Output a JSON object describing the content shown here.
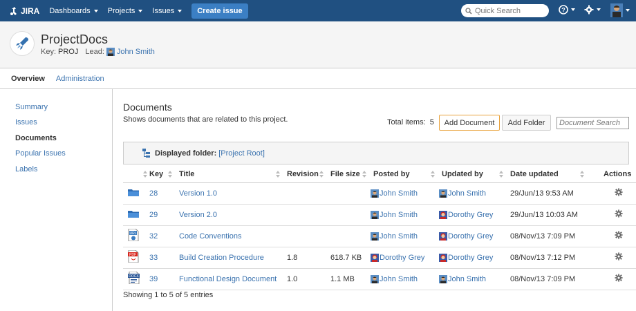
{
  "topnav": {
    "logo_text": "JIRA",
    "menu": [
      {
        "label": "Dashboards"
      },
      {
        "label": "Projects"
      },
      {
        "label": "Issues"
      }
    ],
    "create_label": "Create issue",
    "search_placeholder": "Quick Search",
    "brand_color": "#205081"
  },
  "project": {
    "name": "ProjectDocs",
    "key_label": "Key:",
    "key": "PROJ",
    "lead_label": "Lead:",
    "lead": "John Smith"
  },
  "tabs": [
    {
      "label": "Overview",
      "active": true
    },
    {
      "label": "Administration",
      "active": false
    }
  ],
  "sidebar": {
    "items": [
      {
        "label": "Summary"
      },
      {
        "label": "Issues"
      },
      {
        "label": "Documents"
      },
      {
        "label": "Popular Issues"
      },
      {
        "label": "Labels"
      }
    ]
  },
  "documents": {
    "title": "Documents",
    "subtitle": "Shows documents that are related to this project.",
    "total_label": "Total items:",
    "total": "5",
    "add_document": "Add Document",
    "add_folder": "Add Folder",
    "search_placeholder": "Document Search",
    "folder_label": "Displayed folder:",
    "folder_value": "[Project Root]",
    "columns": [
      "Key",
      "Title",
      "Revision",
      "File size",
      "Posted by",
      "Updated by",
      "Date updated",
      "Actions"
    ],
    "rows": [
      {
        "icon": "folder-icon",
        "key": "28",
        "title": "Version 1.0",
        "revision": "",
        "size": "",
        "posted_by": "John Smith",
        "posted_av": "john",
        "updated_by": "John Smith",
        "updated_av": "john",
        "date": "29/Jun/13 9:53 AM"
      },
      {
        "icon": "folder-icon",
        "key": "29",
        "title": "Version 2.0",
        "revision": "",
        "size": "",
        "posted_by": "John Smith",
        "posted_av": "john",
        "updated_by": "Dorothy Grey",
        "updated_av": "dorothy",
        "date": "29/Jun/13 10:03 AM"
      },
      {
        "icon": "url-file-icon",
        "key": "32",
        "title": "Code Conventions",
        "revision": "",
        "size": "",
        "posted_by": "John Smith",
        "posted_av": "john",
        "updated_by": "Dorothy Grey",
        "updated_av": "dorothy",
        "date": "08/Nov/13 7:09 PM"
      },
      {
        "icon": "pdf-file-icon",
        "key": "33",
        "title": "Build Creation Procedure",
        "revision": "1.8",
        "size": "618.7 KB",
        "posted_by": "Dorothy Grey",
        "posted_av": "dorothy",
        "updated_by": "Dorothy Grey",
        "updated_av": "dorothy",
        "date": "08/Nov/13 7:12 PM"
      },
      {
        "icon": "docx-file-icon",
        "key": "39",
        "title": "Functional Design Document",
        "revision": "1.0",
        "size": "1.1 MB",
        "posted_by": "John Smith",
        "posted_av": "john",
        "updated_by": "John Smith",
        "updated_av": "john",
        "date": "08/Nov/13 7:09 PM"
      }
    ],
    "footer": "Showing 1 to 5 of 5 entries"
  }
}
